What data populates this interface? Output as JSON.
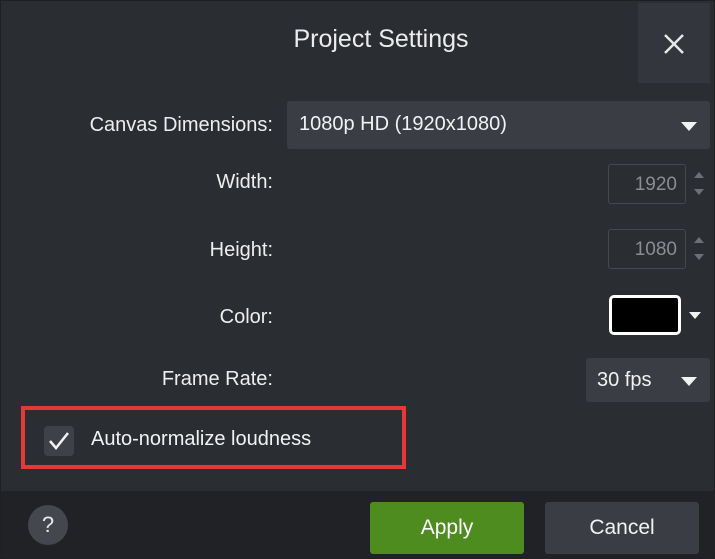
{
  "dialog": {
    "title": "Project Settings",
    "close_icon": "close-icon"
  },
  "canvas": {
    "label": "Canvas Dimensions:",
    "selected": "1080p HD (1920x1080)"
  },
  "width": {
    "label": "Width:",
    "value": "1920"
  },
  "height": {
    "label": "Height:",
    "value": "1080"
  },
  "color": {
    "label": "Color:",
    "value": "#000000"
  },
  "frame_rate": {
    "label": "Frame Rate:",
    "selected": "30 fps"
  },
  "auto_normalize": {
    "label": "Auto-normalize loudness",
    "checked": true
  },
  "footer": {
    "help_label": "?",
    "apply_label": "Apply",
    "cancel_label": "Cancel"
  },
  "colors": {
    "background": "#2a2d32",
    "footer": "#202226",
    "apply": "#4e8c1f",
    "highlight": "#e53935"
  }
}
